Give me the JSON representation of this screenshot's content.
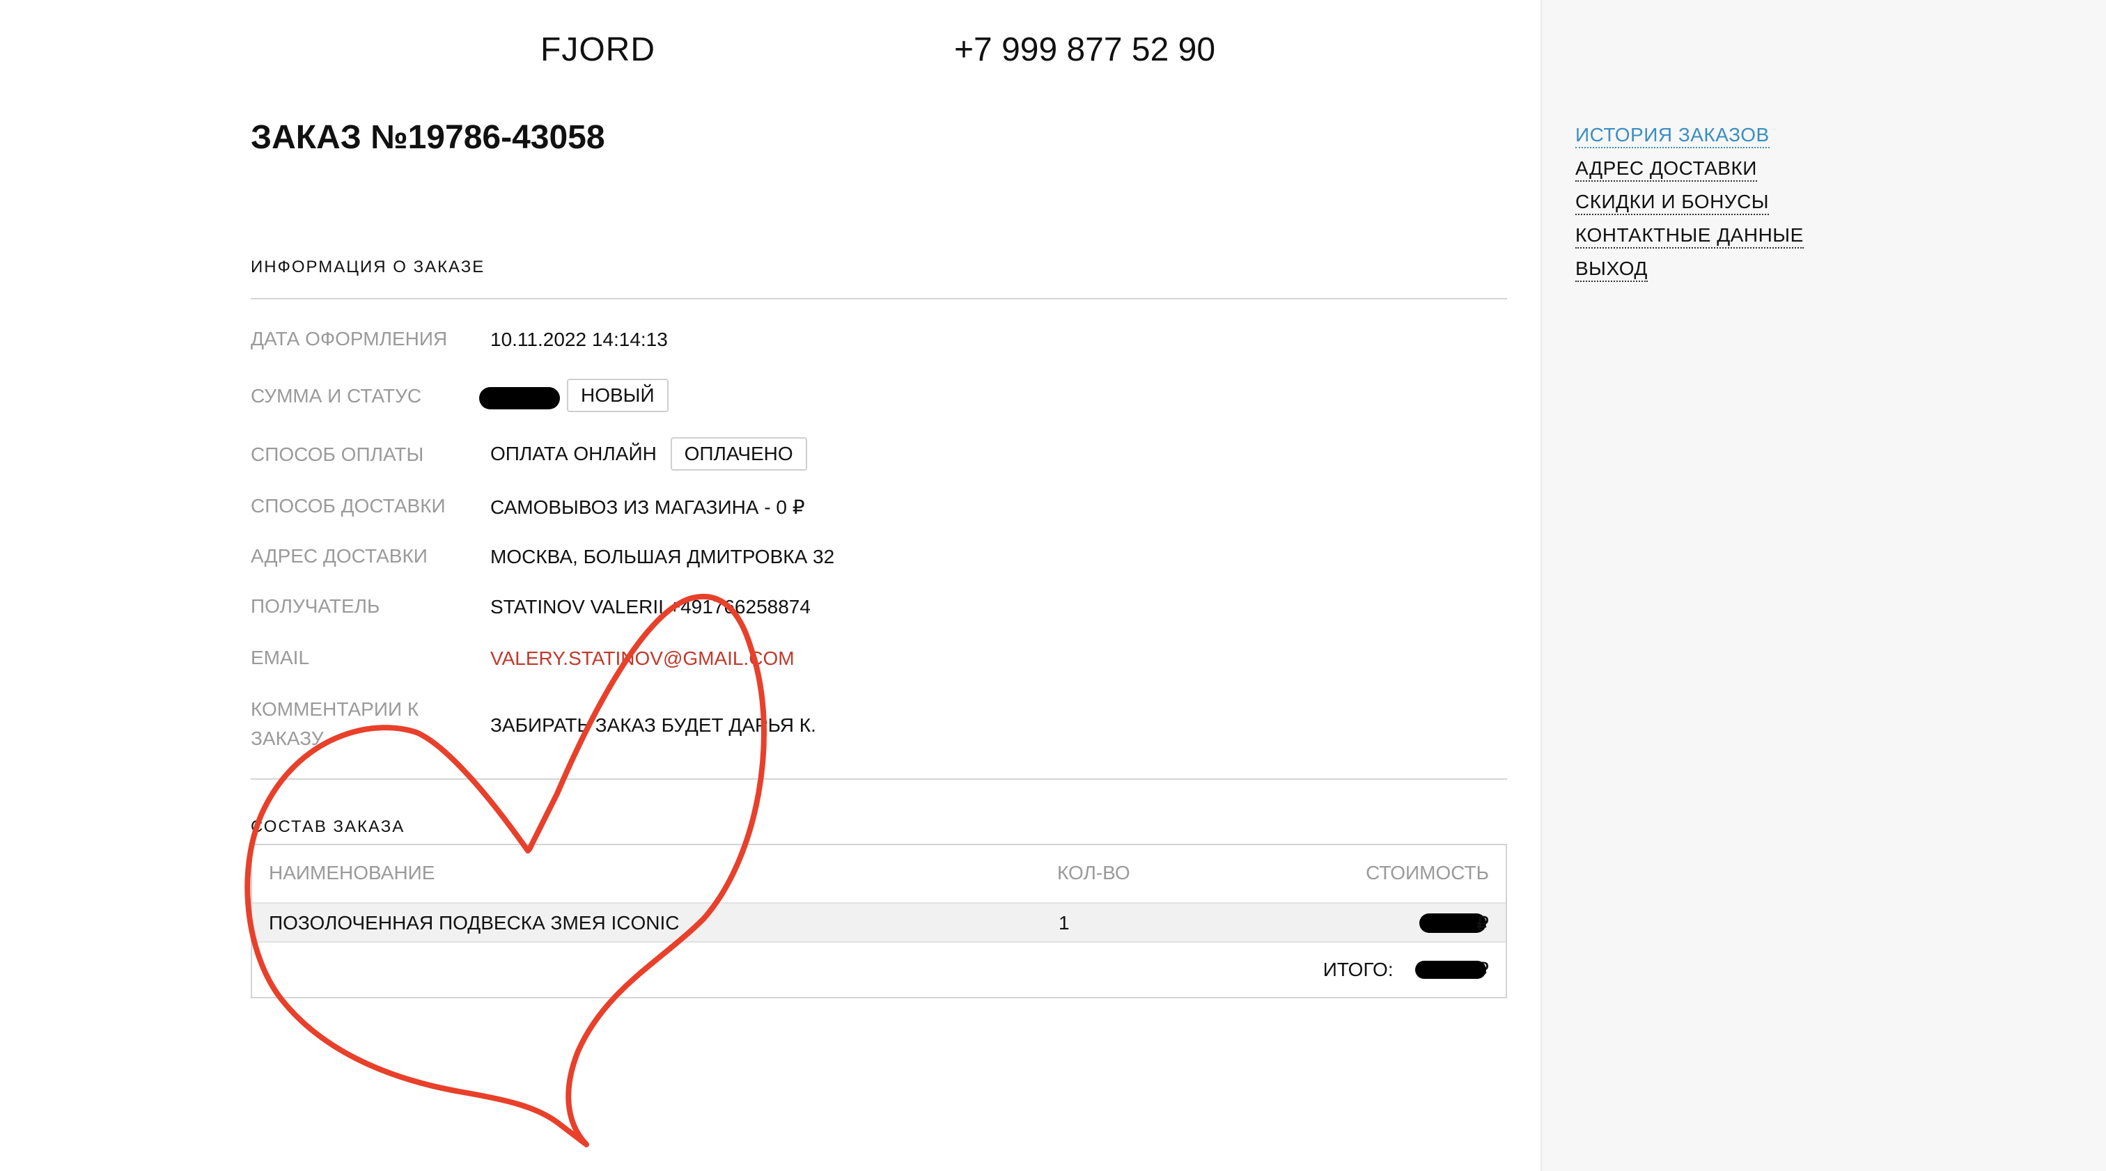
{
  "header": {
    "brand": "FJORD",
    "phone": "+7 999 877 52 90"
  },
  "order": {
    "title": "ЗАКАЗ №19786-43058"
  },
  "info_section": {
    "title": "ИНФОРМАЦИЯ О ЗАКАЗЕ",
    "rows": {
      "date": {
        "label": "ДАТА ОФОРМЛЕНИЯ",
        "value": "10.11.2022 14:14:13"
      },
      "sum_status": {
        "label": "СУММА И СТАТУС",
        "status": "НОВЫЙ"
      },
      "payment": {
        "label": "СПОСОБ ОПЛАТЫ",
        "value": "ОПЛАТА ОНЛАЙН",
        "status": "ОПЛАЧЕНО"
      },
      "delivery": {
        "label": "СПОСОБ ДОСТАВКИ",
        "value": "САМОВЫВОЗ ИЗ МАГАЗИНА - 0 ₽"
      },
      "address": {
        "label": "АДРЕС ДОСТАВКИ",
        "value": "МОСКВА, БОЛЬШАЯ ДМИТРОВКА 32"
      },
      "recipient": {
        "label": "ПОЛУЧАТЕЛЬ",
        "value": "STATINOV VALERII +491766258874"
      },
      "email": {
        "label": "EMAIL",
        "value": "VALERY.STATINOV@GMAIL.COM"
      },
      "comment": {
        "label": "КОММЕНТАРИИ К ЗАКАЗУ",
        "value": "ЗАБИРАТЬ ЗАКАЗ БУДЕТ ДАРЬЯ К."
      }
    }
  },
  "composition": {
    "title": "СОСТАВ ЗАКАЗА",
    "columns": {
      "name": "НАИМЕНОВАНИЕ",
      "qty": "КОЛ-ВО",
      "cost": "СТОИМОСТЬ"
    },
    "items": [
      {
        "name": "ПОЗОЛОЧЕННАЯ ПОДВЕСКА ЗМЕЯ ICONIC",
        "qty": "1",
        "currency": "₽"
      }
    ],
    "total_label": "ИТОГО:",
    "total_currency": "₽"
  },
  "sidebar": {
    "items": [
      {
        "label": "ИСТОРИЯ ЗАКАЗОВ",
        "active": true
      },
      {
        "label": "АДРЕС ДОСТАВКИ"
      },
      {
        "label": "СКИДКИ И БОНУСЫ"
      },
      {
        "label": "КОНТАКТНЫЕ ДАННЫЕ"
      },
      {
        "label": "ВЫХОД"
      }
    ]
  },
  "colors": {
    "accent": "#3a8ec4",
    "email": "#c0392b",
    "heart": "#e8402a"
  }
}
